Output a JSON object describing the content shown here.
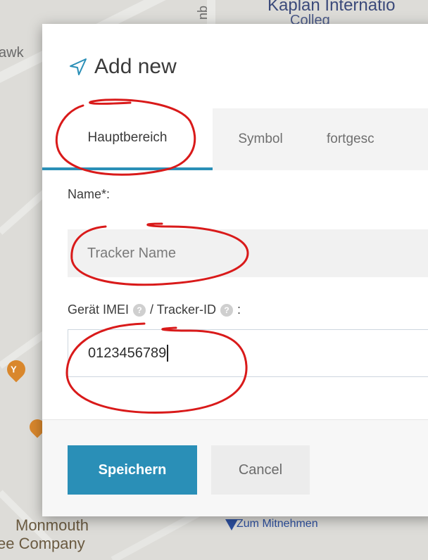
{
  "map": {
    "labels": {
      "kaplan": "Kaplan Internatio",
      "kaplan2": "Colleg",
      "awk": "awk",
      "monmouth": "Monmouth",
      "company": "ee Company",
      "mitnehmen": "Zum Mitnehmen",
      "vertical": "qu"
    }
  },
  "modal": {
    "title": "Add new",
    "title_icon": "navigation-arrow-icon",
    "tabs": [
      {
        "label": "Hauptbereich",
        "active": true
      },
      {
        "label": "Symbol",
        "active": false
      },
      {
        "label": "fortgesc",
        "active": false
      }
    ],
    "fields": {
      "name": {
        "label": "Name*:",
        "placeholder": "Tracker Name",
        "value": ""
      },
      "imei": {
        "label_part1": "Gerät IMEI",
        "label_part2": "/ Tracker-ID",
        "label_part3": ":",
        "value": "0123456789"
      }
    },
    "buttons": {
      "save": "Speichern",
      "cancel": "Cancel"
    },
    "accent_color": "#2a8fb7",
    "annotation_color": "#d91a1a"
  }
}
